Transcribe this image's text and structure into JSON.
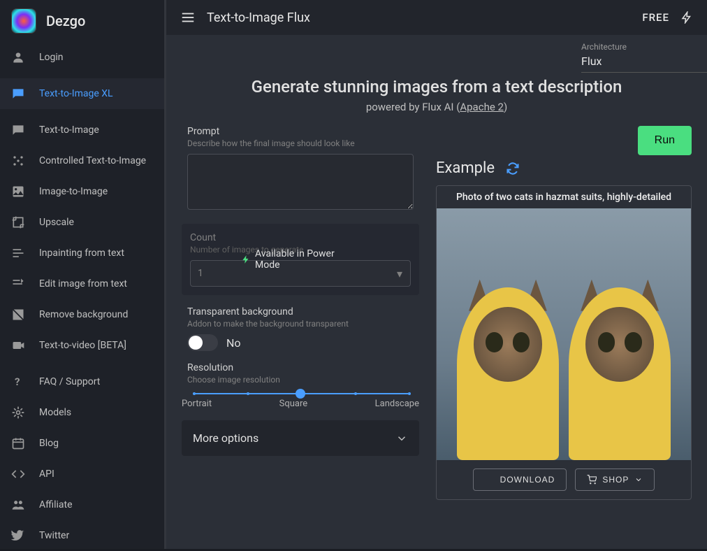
{
  "brand": {
    "name": "Dezgo"
  },
  "topbar": {
    "title": "Text-to-Image Flux",
    "free_label": "FREE"
  },
  "architecture": {
    "label": "Architecture",
    "value": "Flux"
  },
  "hero": {
    "heading": "Generate stunning images from a text description",
    "subtext_prefix": "powered by Flux AI (",
    "license_link": "Apache 2",
    "subtext_suffix": ")"
  },
  "sidebar": {
    "login": "Login",
    "active": "Text-to-Image XL",
    "items": [
      "Text-to-Image",
      "Controlled Text-to-Image",
      "Image-to-Image",
      "Upscale",
      "Inpainting from text",
      "Edit image from text",
      "Remove background",
      "Text-to-video [BETA]"
    ],
    "footer": [
      "FAQ / Support",
      "Models",
      "Blog",
      "API",
      "Affiliate",
      "Twitter"
    ]
  },
  "form": {
    "run": "Run",
    "prompt": {
      "label": "Prompt",
      "hint": "Describe how the final image should look like",
      "value": ""
    },
    "count": {
      "label": "Count",
      "hint": "Number of images to generate",
      "value": "1",
      "power_mode": "Available in Power Mode"
    },
    "transparent": {
      "label": "Transparent background",
      "hint": "Addon to make the background transparent",
      "value": "No"
    },
    "resolution": {
      "label": "Resolution",
      "hint": "Choose image resolution",
      "options": [
        "Portrait",
        "Square",
        "Landscape"
      ]
    },
    "more": "More options"
  },
  "example": {
    "title": "Example",
    "caption": "Photo of two cats in hazmat suits, highly-detailed",
    "download": "DOWNLOAD",
    "shop": "SHOP"
  }
}
